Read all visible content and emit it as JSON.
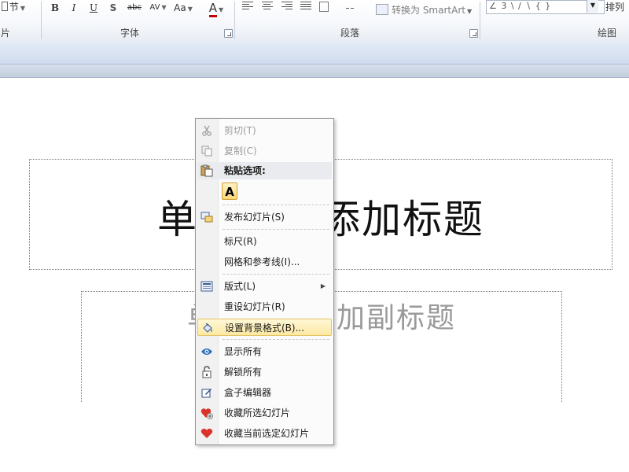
{
  "ribbon": {
    "section_button": "节",
    "bold": "B",
    "italic": "I",
    "underline": "U",
    "shadow": "S",
    "strike": "abc",
    "spacing": "AV",
    "case": "Aa",
    "color": "A",
    "convert_smartart": "转换为 SmartArt",
    "shapes_preview": "∠ 3 \\ ∕ ∖ { }",
    "arrange": "排列",
    "groups": {
      "slides_partial": "片",
      "font": "字体",
      "paragraph": "段落",
      "drawing": "绘图"
    }
  },
  "slide": {
    "title_placeholder": "单击此处添加标题",
    "subtitle_placeholder": "单击此处添加副标题"
  },
  "context_menu": {
    "cut": "剪切(T)",
    "copy": "复制(C)",
    "paste_options": "粘贴选项:",
    "paste_keep_text": "A",
    "publish_slides": "发布幻灯片(S)",
    "ruler": "标尺(R)",
    "grid_guides": "网格和参考线(I)...",
    "layout": "版式(L)",
    "reset_slide": "重设幻灯片(R)",
    "format_background": "设置背景格式(B)...",
    "show_all": "显示所有",
    "unlock_all": "解锁所有",
    "box_editor": "盒子编辑器",
    "favorite_selected": "收藏所选幻灯片",
    "favorite_current": "收藏当前选定幻灯片"
  },
  "colors": {
    "highlight": "#fde9a3",
    "heart": "#d9342b",
    "eye": "#2a6fb5"
  }
}
